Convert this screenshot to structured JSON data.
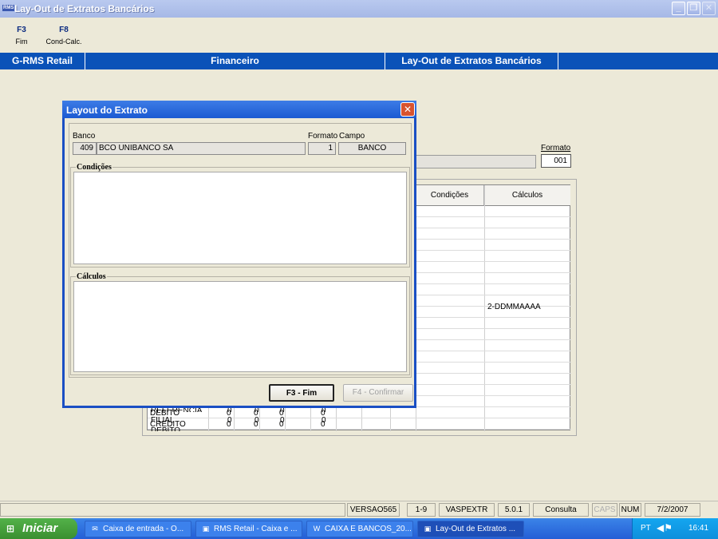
{
  "window": {
    "title": "Lay-Out de Extratos Bancários",
    "app_badge": "RMS"
  },
  "fkeys": [
    {
      "key": "F3",
      "label": "Fim"
    },
    {
      "key": "F8",
      "label": "Cond-Calc."
    }
  ],
  "navbar": {
    "left": "G-RMS Retail",
    "center": "Financeiro",
    "right": "Lay-Out de Extratos Bancários"
  },
  "background": {
    "formato_label": "Formato",
    "formato_value": "001",
    "grid_headers": {
      "condicoes": "Condições",
      "calculos": "Cálculos"
    },
    "calculo_value": "2-DDMMAAAA",
    "rows": [
      {
        "name": "REFERENCIA",
        "c1": "0",
        "c2": "0",
        "c3": "0",
        "c4": "0"
      },
      {
        "name": "FILIAL",
        "c1": "0",
        "c2": "0",
        "c3": "0",
        "c4": "0"
      },
      {
        "name": "DEBITO",
        "c1": "0",
        "c2": "0",
        "c3": "0",
        "c4": "0"
      },
      {
        "name": "CREDITO",
        "c1": "0",
        "c2": "0",
        "c3": "0",
        "c4": "0"
      }
    ]
  },
  "dialog": {
    "title": "Layout do Extrato",
    "banco_label": "Banco",
    "banco_code": "409",
    "banco_name": "BCO UNIBANCO SA",
    "formato_label": "Formato",
    "campo_label": "Campo",
    "formato_value": "1",
    "campo_value": "BANCO",
    "condicoes_label": "Condições",
    "calculos_label": "Cálculos",
    "fim_button": "F3 - Fim",
    "confirmar_button": "F4 - Confirmar"
  },
  "statusbar": {
    "versao": "VERSAO565",
    "range": "1-9",
    "program": "VASPEXTR",
    "version": "5.0.1",
    "mode": "Consulta",
    "caps": "CAPS",
    "num": "NUM",
    "date": "7/2/2007"
  },
  "taskbar": {
    "start": "Iniciar",
    "tasks": [
      {
        "label": "Caixa de entrada - O...",
        "icon": "mail-icon"
      },
      {
        "label": "RMS Retail - Caixa e ...",
        "icon": "rms-icon"
      },
      {
        "label": "CAIXA E BANCOS_20...",
        "icon": "word-icon"
      },
      {
        "label": "Lay-Out de Extratos ...",
        "icon": "rms-icon"
      }
    ],
    "lang": "PT",
    "time": "16:41"
  }
}
